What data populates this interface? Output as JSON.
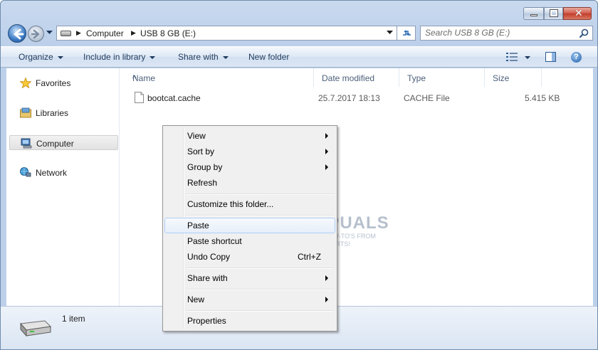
{
  "window": {
    "controls": {
      "minimize": "minimize-icon",
      "maximize": "maximize-icon",
      "close": "close-icon",
      "close_glyph": "✕"
    }
  },
  "address_bar": {
    "crumbs": [
      "Computer",
      "USB 8 GB (E:)"
    ],
    "search_placeholder": "Search USB 8 GB (E:)"
  },
  "toolbar": {
    "organize": "Organize",
    "include_in_library": "Include in library",
    "share_with": "Share with",
    "new_folder": "New folder",
    "help_glyph": "?"
  },
  "nav_pane": {
    "items": [
      {
        "label": "Favorites",
        "icon": "star-icon"
      },
      {
        "label": "Libraries",
        "icon": "libraries-icon"
      },
      {
        "label": "Computer",
        "icon": "computer-icon",
        "selected": true
      },
      {
        "label": "Network",
        "icon": "network-icon"
      }
    ]
  },
  "file_list": {
    "columns": [
      "Name",
      "Date modified",
      "Type",
      "Size"
    ],
    "sort_glyph": "^",
    "rows": [
      {
        "name": "bootcat.cache",
        "date_modified": "25.7.2017 18:13",
        "type": "CACHE File",
        "size": "5.415 KB"
      }
    ]
  },
  "details_pane": {
    "item_count": "1 item"
  },
  "context_menu": {
    "items": [
      {
        "label": "View",
        "submenu": true
      },
      {
        "label": "Sort by",
        "submenu": true
      },
      {
        "label": "Group by",
        "submenu": true
      },
      {
        "label": "Refresh"
      },
      {
        "label": "Customize this folder..."
      },
      {
        "label": "Paste",
        "highlighted": true
      },
      {
        "label": "Paste shortcut"
      },
      {
        "label": "Undo Copy",
        "shortcut": "Ctrl+Z"
      },
      {
        "label": "Share with",
        "submenu": true
      },
      {
        "label": "New",
        "submenu": true
      },
      {
        "label": "Properties"
      }
    ]
  },
  "watermark": {
    "title": "APPUALS",
    "subtitle_line1": "TECH HOW-TO'S FROM",
    "subtitle_line2": "THE EXPERTS!"
  },
  "colors": {
    "frame": "#bcd0ea",
    "toolbar_text": "#1e395b",
    "menu_bg": "#f0f0f0",
    "menu_highlight_border": "#aecff7"
  }
}
